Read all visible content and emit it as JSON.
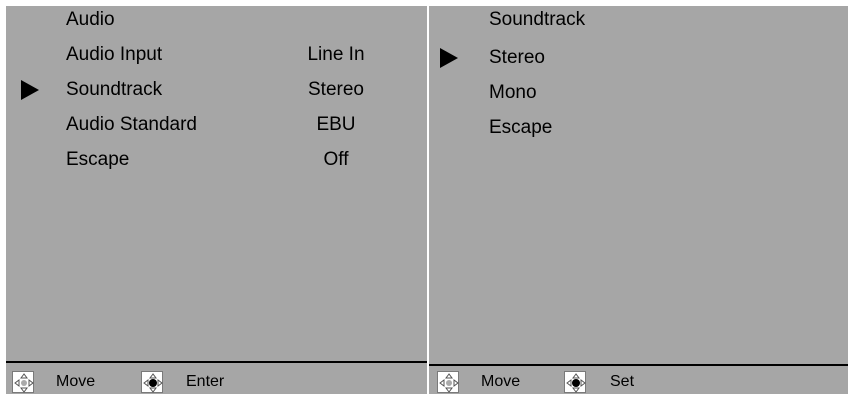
{
  "left_menu": {
    "title": "Audio",
    "items": [
      {
        "label": "Audio Input",
        "value": "Line In"
      },
      {
        "label": "Soundtrack",
        "value": "Stereo",
        "selected": true
      },
      {
        "label": "Audio Standard",
        "value": "EBU"
      },
      {
        "label": "Escape",
        "value": "Off"
      }
    ],
    "footer": {
      "move_label": "Move",
      "action_label": "Enter"
    }
  },
  "right_menu": {
    "title": "Soundtrack",
    "options": [
      {
        "label": "Stereo",
        "selected": true
      },
      {
        "label": "Mono"
      },
      {
        "label": "Escape"
      }
    ],
    "footer": {
      "move_label": "Move",
      "action_label": "Set"
    }
  },
  "colors": {
    "panel_bg": "#a6a6a6",
    "text": "#000000"
  },
  "icons": {
    "move": "dpad-leftright-icon",
    "enter": "dpad-updown-icon"
  }
}
